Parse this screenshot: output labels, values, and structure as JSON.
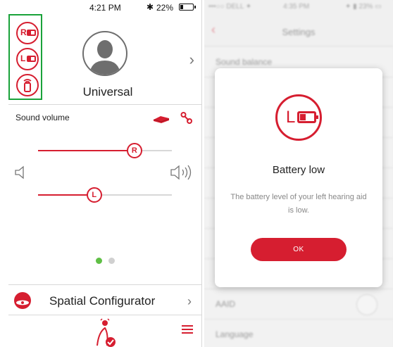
{
  "left_screen": {
    "status_bar": {
      "time": "4:21 PM",
      "bluetooth_icon": "bluetooth-icon",
      "battery_percent": "22%",
      "battery_level": 0.22
    },
    "hearing_aids": [
      {
        "letter": "R",
        "icon": "right-aid-battery-icon"
      },
      {
        "letter": "L",
        "icon": "left-aid-battery-icon"
      },
      {
        "letter": "",
        "icon": "streamer-device-icon"
      }
    ],
    "profile": {
      "name": "Universal",
      "next_icon": "chevron-right-icon"
    },
    "sound_volume": {
      "label": "Sound volume",
      "right_aid": {
        "letter": "R",
        "level": 0.72
      },
      "left_aid": {
        "letter": "L",
        "level": 0.42
      },
      "icons": [
        "mute-speaker-icon",
        "loud-speaker-icon",
        "device-icon",
        "link-icon"
      ]
    },
    "pager": {
      "active": 0,
      "count": 2
    },
    "spatial": {
      "label": "Spatial Configurator",
      "icon": "spatial-icon"
    },
    "tab_bar": {
      "home_icon": "hearing-aid-home-icon",
      "menu_icon": "hamburger-menu-icon"
    },
    "colors": {
      "accent": "#d61e30",
      "highlight": "#1aa23a",
      "pager_active": "#5fbf45",
      "pager_inactive": "#d0d0d0"
    }
  },
  "right_screen": {
    "background": {
      "status_bar": {
        "carrier": "•••○○ DELL ✦",
        "time": "4:35 PM",
        "battery": "✦ ▮ 23% ▭"
      },
      "nav_title": "Settings",
      "rows": [
        {
          "label": "Sound balance"
        },
        {
          "label": ""
        },
        {
          "label": ""
        },
        {
          "label": ""
        },
        {
          "label": ""
        },
        {
          "label": ""
        },
        {
          "label": ""
        },
        {
          "label": "AAID"
        },
        {
          "label": "Language"
        }
      ]
    },
    "dialog": {
      "icon_letter": "L",
      "title": "Battery low",
      "message": "The battery level of your left hearing aid is low.",
      "ok_label": "OK"
    }
  }
}
